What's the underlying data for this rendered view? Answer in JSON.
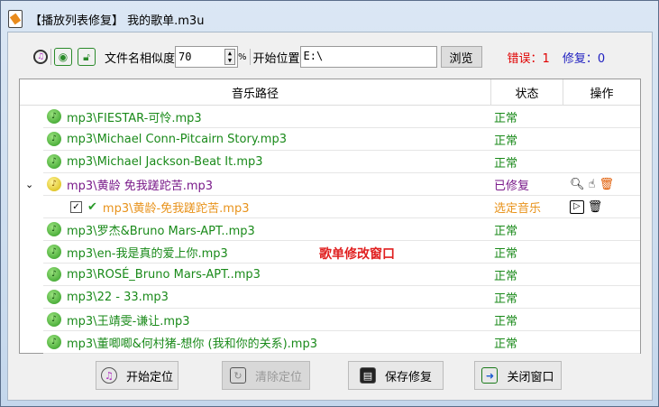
{
  "window": {
    "title": "【播放列表修复】 我的歌单.m3u"
  },
  "toolbar": {
    "similarity_label": "文件名相似度",
    "similarity_value": "70",
    "percent": "%",
    "start_label": "开始位置",
    "start_value": "E:\\",
    "browse": "浏览",
    "error_label": "错误：1",
    "fixed_label": "修复：0"
  },
  "table": {
    "headers": [
      "音乐路径",
      "状态",
      "操作"
    ],
    "rows": [
      {
        "path": "mp3\\FIESTAR-可怜.mp3",
        "status": "正常"
      },
      {
        "path": "mp3\\Michael Conn-Pitcairn Story.mp3",
        "status": "正常"
      },
      {
        "path": "mp3\\Michael Jackson-Beat It.mp3",
        "status": "正常"
      },
      {
        "path": "mp3\\黄龄 免我蹉跎苦.mp3",
        "status": "已修复"
      },
      {
        "path": "mp3\\黄龄-免我蹉跎苦.mp3",
        "status": "选定音乐"
      },
      {
        "path": "mp3\\罗杰&Bruno Mars-APT..mp3",
        "status": "正常"
      },
      {
        "path": "mp3\\en-我是真的爱上你.mp3",
        "status": "正常"
      },
      {
        "path": "mp3\\ROSÉ_Bruno Mars-APT..mp3",
        "status": "正常"
      },
      {
        "path": "mp3\\22 - 33.mp3",
        "status": "正常"
      },
      {
        "path": "mp3\\王靖雯-谦让.mp3",
        "status": "正常"
      },
      {
        "path": "mp3\\董唧唧&何村猪-想你 (我和你的关系).mp3",
        "status": "正常"
      }
    ]
  },
  "annotation": "歌单修改窗口",
  "buttons": {
    "start": "开始定位",
    "clear": "清除定位",
    "save": "保存修复",
    "close": "关闭窗口"
  },
  "colors": {
    "normal": "#1a8a1a",
    "fixed": "#7a1a8a",
    "selected": "#e8931c",
    "error": "#e00000",
    "fix": "#2020c0"
  }
}
